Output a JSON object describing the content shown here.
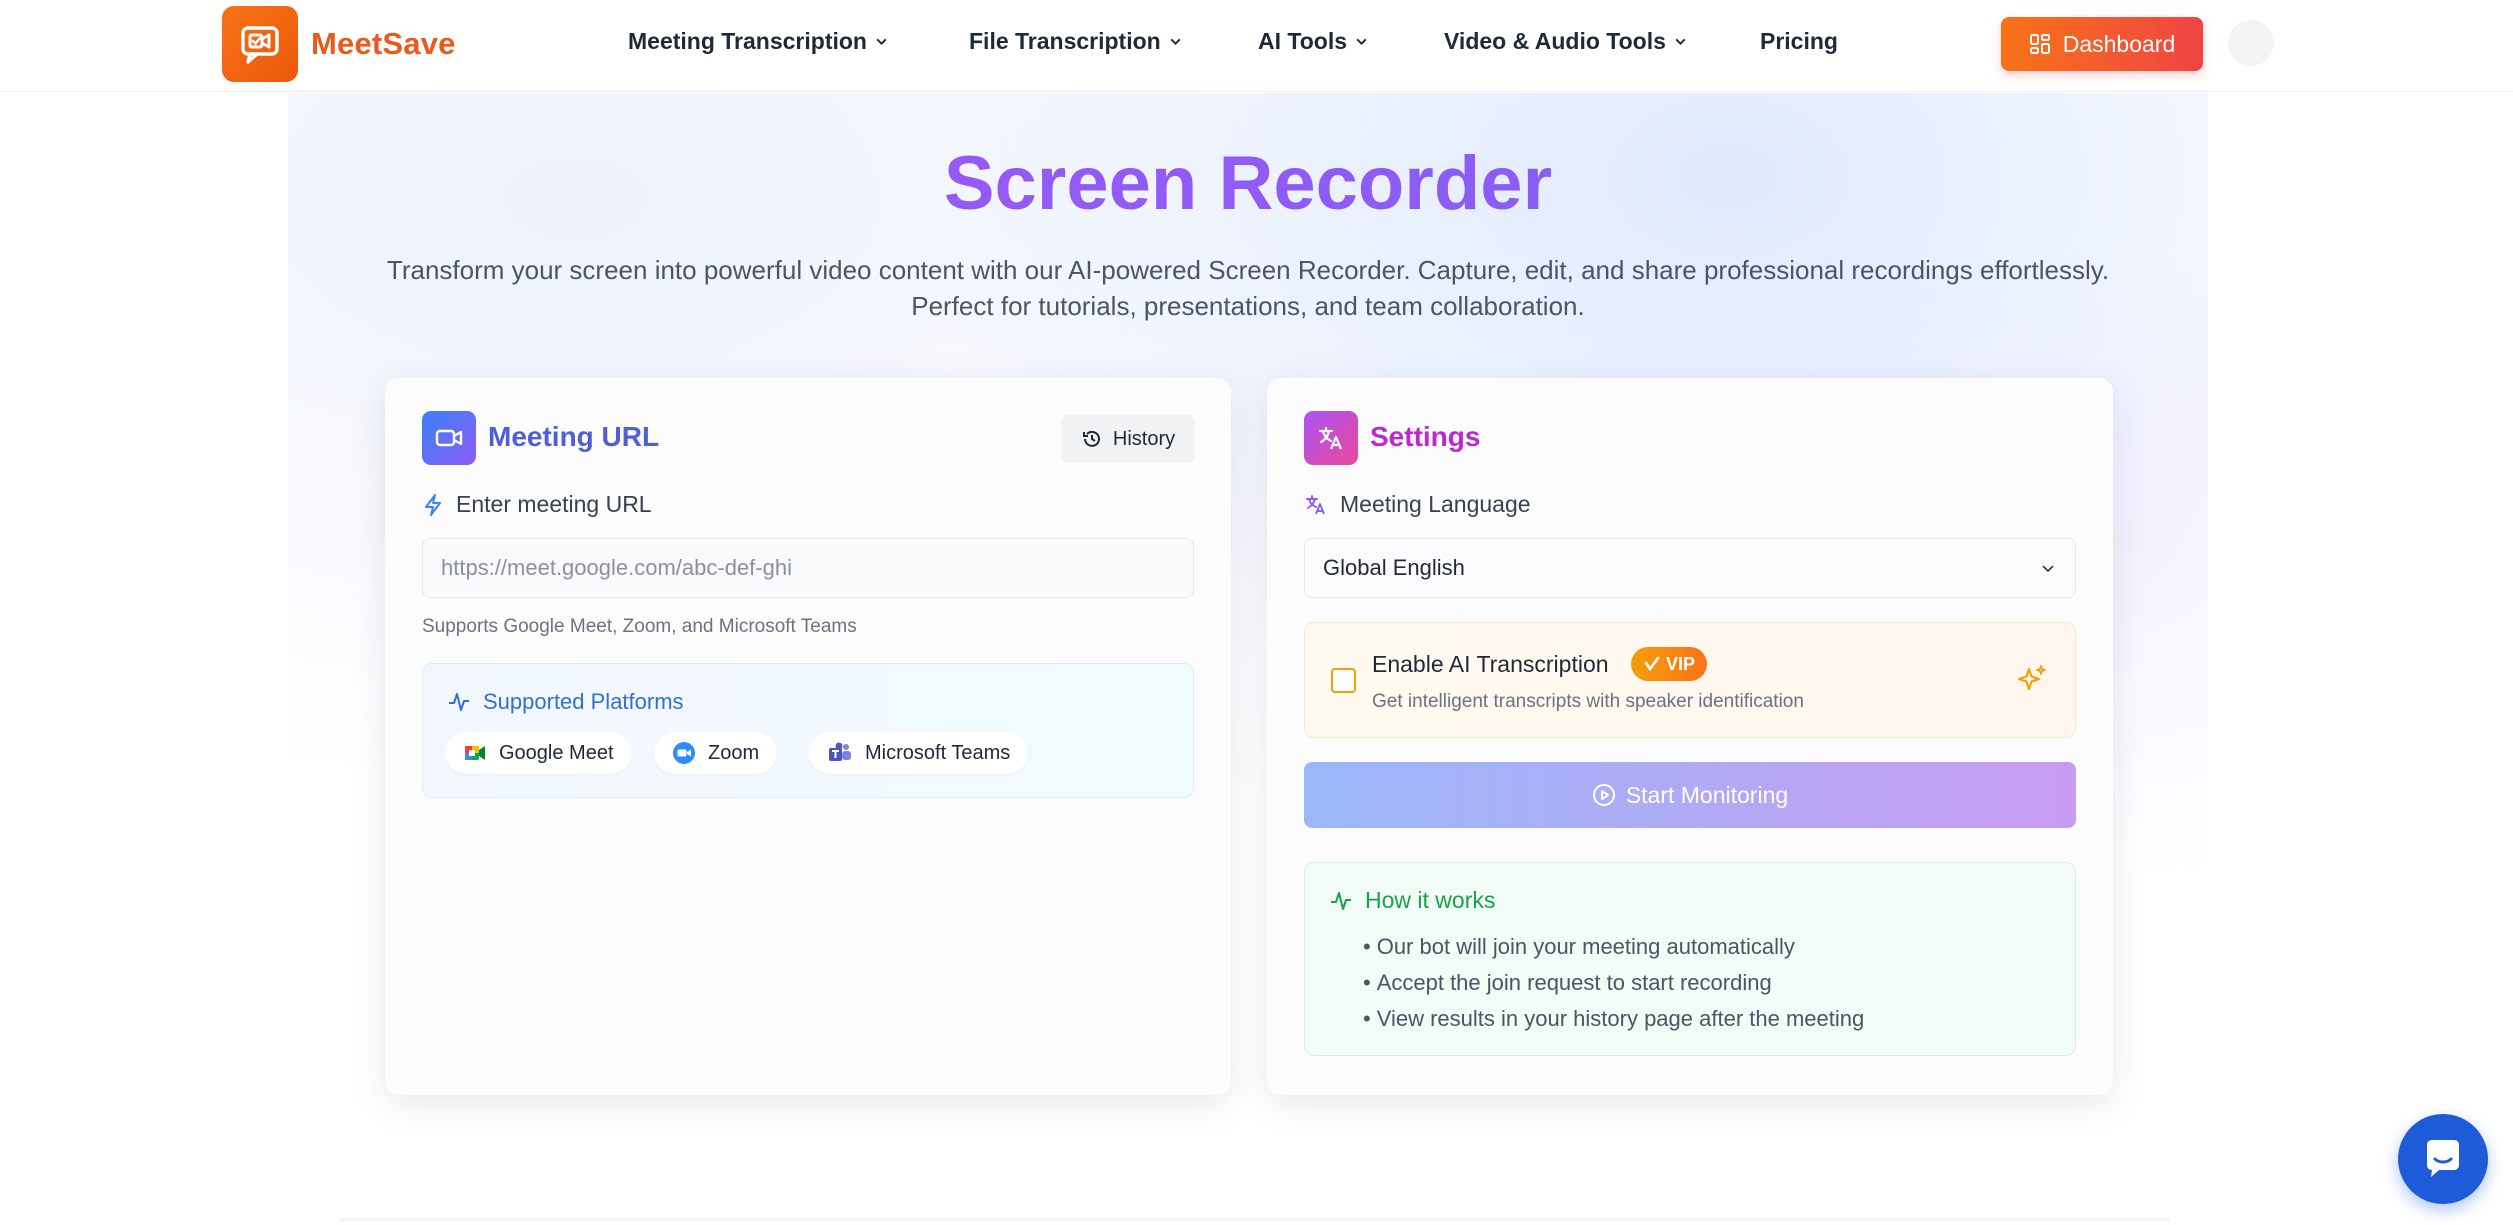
{
  "brand": {
    "name": "MeetSave"
  },
  "nav": {
    "items": [
      {
        "label": "Meeting Transcription",
        "dropdown": true
      },
      {
        "label": "File Transcription",
        "dropdown": true
      },
      {
        "label": "AI Tools",
        "dropdown": true
      },
      {
        "label": "Video & Audio Tools",
        "dropdown": true
      },
      {
        "label": "Pricing",
        "dropdown": false
      }
    ],
    "dashboard_label": "Dashboard"
  },
  "hero": {
    "title": "Screen Recorder",
    "subtitle_line1": "Transform your screen into powerful video content with our AI-powered Screen Recorder. Capture, edit, and share professional recordings effortlessly.",
    "subtitle_line2": "Perfect for tutorials, presentations, and team collaboration."
  },
  "meeting_card": {
    "title": "Meeting URL",
    "history_label": "History",
    "field_label": "Enter meeting URL",
    "input_placeholder": "https://meet.google.com/abc-def-ghi",
    "input_value": "",
    "hint": "Supports Google Meet, Zoom, and Microsoft Teams",
    "platforms_title": "Supported Platforms",
    "platforms": [
      {
        "label": "Google Meet",
        "icon": "google-meet-icon"
      },
      {
        "label": "Zoom",
        "icon": "zoom-icon"
      },
      {
        "label": "Microsoft Teams",
        "icon": "microsoft-teams-icon"
      }
    ]
  },
  "settings_card": {
    "title": "Settings",
    "language_label": "Meeting Language",
    "language_value": "Global English",
    "ai_title": "Enable AI Transcription",
    "vip_label": "VIP",
    "ai_subtitle": "Get intelligent transcripts with speaker identification",
    "ai_enabled": false,
    "start_label": "Start Monitoring",
    "how_title": "How it works",
    "how_steps": [
      "Our bot will join your meeting automatically",
      "Accept the join request to start recording",
      "View results in your history page after the meeting"
    ]
  },
  "colors": {
    "brand_orange": "#ea5a1c",
    "title_purple": "#8b5cf6",
    "meeting_blue": "#4f5fd6",
    "settings_magenta": "#c026d3",
    "how_green": "#16a34a",
    "chat_blue": "#1e5bd8"
  }
}
